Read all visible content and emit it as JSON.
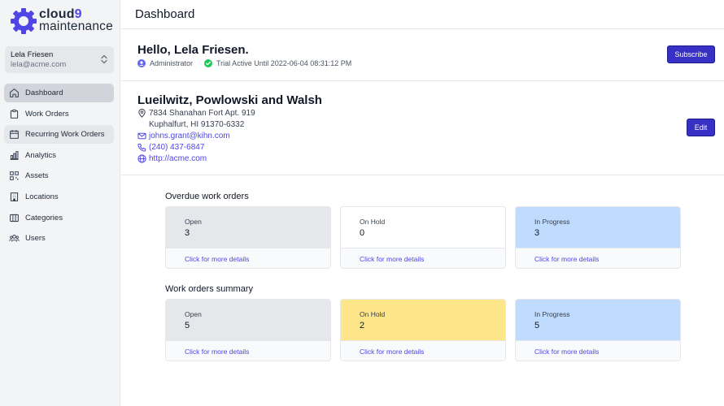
{
  "brand": {
    "name_prefix": "cloud",
    "name_suffix": "9",
    "subtitle": "maintenance",
    "accent": "#4f46e5"
  },
  "user": {
    "name": "Lela Friesen",
    "email": "lela@acme.com"
  },
  "nav": [
    {
      "label": "Dashboard",
      "icon": "home-icon",
      "active": true
    },
    {
      "label": "Work Orders",
      "icon": "clipboard-icon"
    },
    {
      "label": "Recurring Work Orders",
      "icon": "calendar-icon",
      "hover": true
    },
    {
      "label": "Analytics",
      "icon": "chart-icon"
    },
    {
      "label": "Assets",
      "icon": "qr-icon"
    },
    {
      "label": "Locations",
      "icon": "building-icon"
    },
    {
      "label": "Categories",
      "icon": "columns-icon"
    },
    {
      "label": "Users",
      "icon": "users-icon"
    }
  ],
  "header": {
    "title": "Dashboard"
  },
  "greeting": {
    "title": "Hello, Lela Friesen.",
    "role": "Administrator",
    "trial": "Trial Active Until 2022-06-04 08:31:12 PM",
    "subscribe_label": "Subscribe"
  },
  "company": {
    "name": "Lueilwitz, Powlowski and Walsh",
    "address_line1": "7834 Shanahan Fort Apt. 919",
    "address_line2": "Kuphalfurt, HI 91370-6332",
    "email": "johns.grant@kihn.com",
    "phone": "(240) 437-6847",
    "website": "http://acme.com",
    "edit_label": "Edit"
  },
  "overdue": {
    "title": "Overdue work orders",
    "cards": [
      {
        "label": "Open",
        "value": "3",
        "link": "Click for more details",
        "color": "#e5e7eb"
      },
      {
        "label": "On Hold",
        "value": "0",
        "link": "Click for more details",
        "color": "#ffffff"
      },
      {
        "label": "In Progress",
        "value": "3",
        "link": "Click for more details",
        "color": "#bfdbfe"
      }
    ]
  },
  "summary": {
    "title": "Work orders summary",
    "cards": [
      {
        "label": "Open",
        "value": "5",
        "link": "Click for more details",
        "color": "#e5e7eb"
      },
      {
        "label": "On Hold",
        "value": "2",
        "link": "Click for more details",
        "color": "#fde68a"
      },
      {
        "label": "In Progress",
        "value": "5",
        "link": "Click for more details",
        "color": "#bfdbfe"
      }
    ]
  }
}
